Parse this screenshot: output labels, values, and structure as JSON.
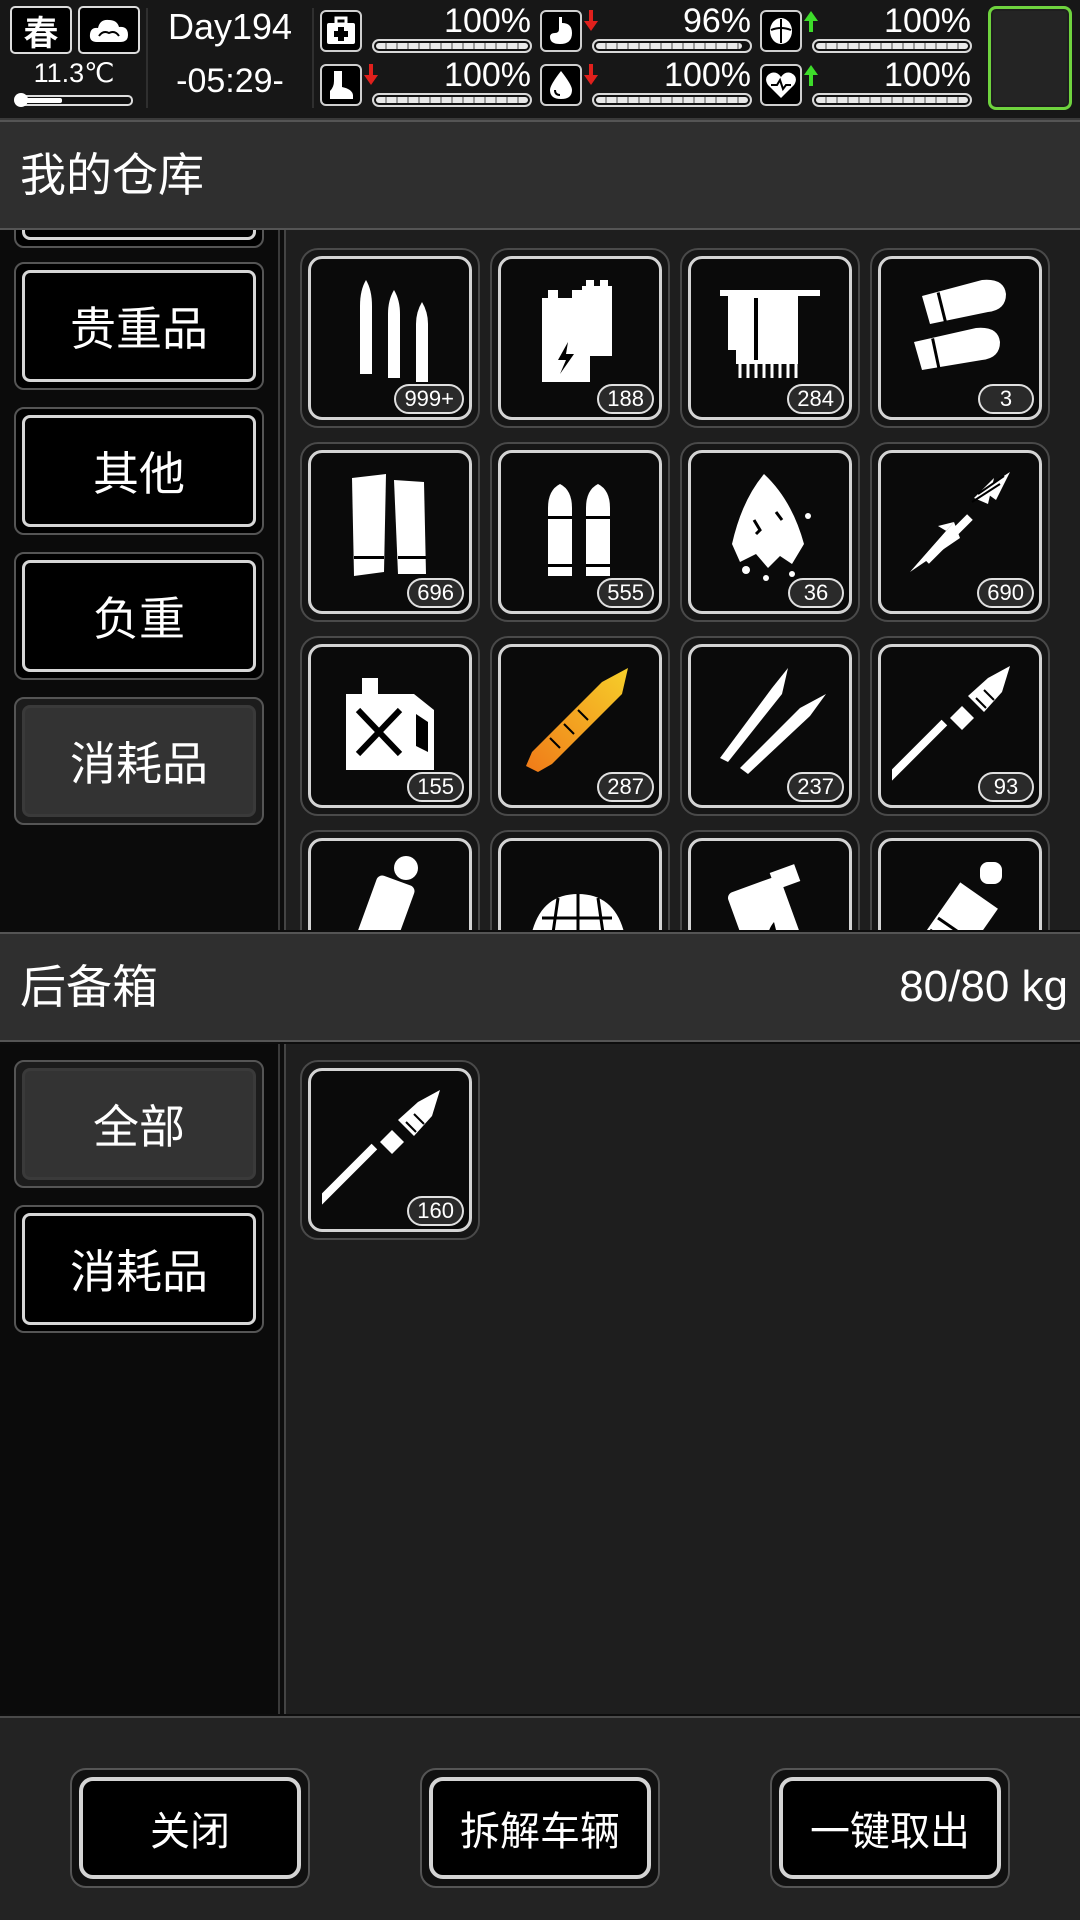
{
  "status": {
    "season": "春",
    "weather_icon": "cloud-icon",
    "temperature": "11.3℃",
    "day": "Day194",
    "clock": "-05:29-",
    "stats": [
      {
        "id": "health",
        "icon": "medkit-icon",
        "pct": "100%",
        "value": 1.0,
        "trend": "none"
      },
      {
        "id": "hunger",
        "icon": "stomach-icon",
        "pct": "96%",
        "value": 0.96,
        "trend": "down"
      },
      {
        "id": "mood",
        "icon": "brain-icon",
        "pct": "100%",
        "value": 1.0,
        "trend": "up"
      },
      {
        "id": "stamina",
        "icon": "foot-icon",
        "pct": "100%",
        "value": 1.0,
        "trend": "down"
      },
      {
        "id": "thirst",
        "icon": "water-drop-icon",
        "pct": "100%",
        "value": 1.0,
        "trend": "down"
      },
      {
        "id": "heart",
        "icon": "heart-icon",
        "pct": "100%",
        "value": 1.0,
        "trend": "up"
      }
    ],
    "colors": {
      "up": "#3ddc2a",
      "down": "#e0201c",
      "portrait_border": "#6fd33e"
    }
  },
  "warehouse": {
    "title": "我的仓库",
    "categories": [
      {
        "label": "贵重品",
        "active": false
      },
      {
        "label": "其他",
        "active": false
      },
      {
        "label": "负重",
        "active": false
      },
      {
        "label": "消耗品",
        "active": true
      }
    ],
    "items": [
      {
        "icon": "rifle-ammo-icon",
        "qty": "999+"
      },
      {
        "icon": "battery-icon",
        "qty": "188"
      },
      {
        "icon": "towel-icon",
        "qty": "284"
      },
      {
        "icon": "shotgun-shell-icon",
        "qty": "3"
      },
      {
        "icon": "shotgun-cartridge-icon",
        "qty": "696"
      },
      {
        "icon": "pistol-ammo-icon",
        "qty": "555"
      },
      {
        "icon": "torn-cloth-icon",
        "qty": "36"
      },
      {
        "icon": "arrow-icon",
        "qty": "690"
      },
      {
        "icon": "fuel-can-icon",
        "qty": "155"
      },
      {
        "icon": "rocket-orange-icon",
        "qty": "287"
      },
      {
        "icon": "sniper-round-icon",
        "qty": "237"
      },
      {
        "icon": "rpg-rocket-icon",
        "qty": "93"
      },
      {
        "icon": "grenade-icon",
        "qty": ""
      },
      {
        "icon": "net-icon",
        "qty": ""
      },
      {
        "icon": "fire-grenade-icon",
        "qty": ""
      },
      {
        "icon": "frag-grenade-icon",
        "qty": ""
      }
    ]
  },
  "trunk": {
    "title": "后备箱",
    "weight": "80/80 kg",
    "categories": [
      {
        "label": "全部",
        "active": true
      },
      {
        "label": "消耗品",
        "active": false
      }
    ],
    "items": [
      {
        "icon": "rpg-rocket-icon",
        "qty": "160"
      }
    ]
  },
  "footer": {
    "close": "关闭",
    "dismantle": "拆解车辆",
    "take_all": "一键取出"
  }
}
